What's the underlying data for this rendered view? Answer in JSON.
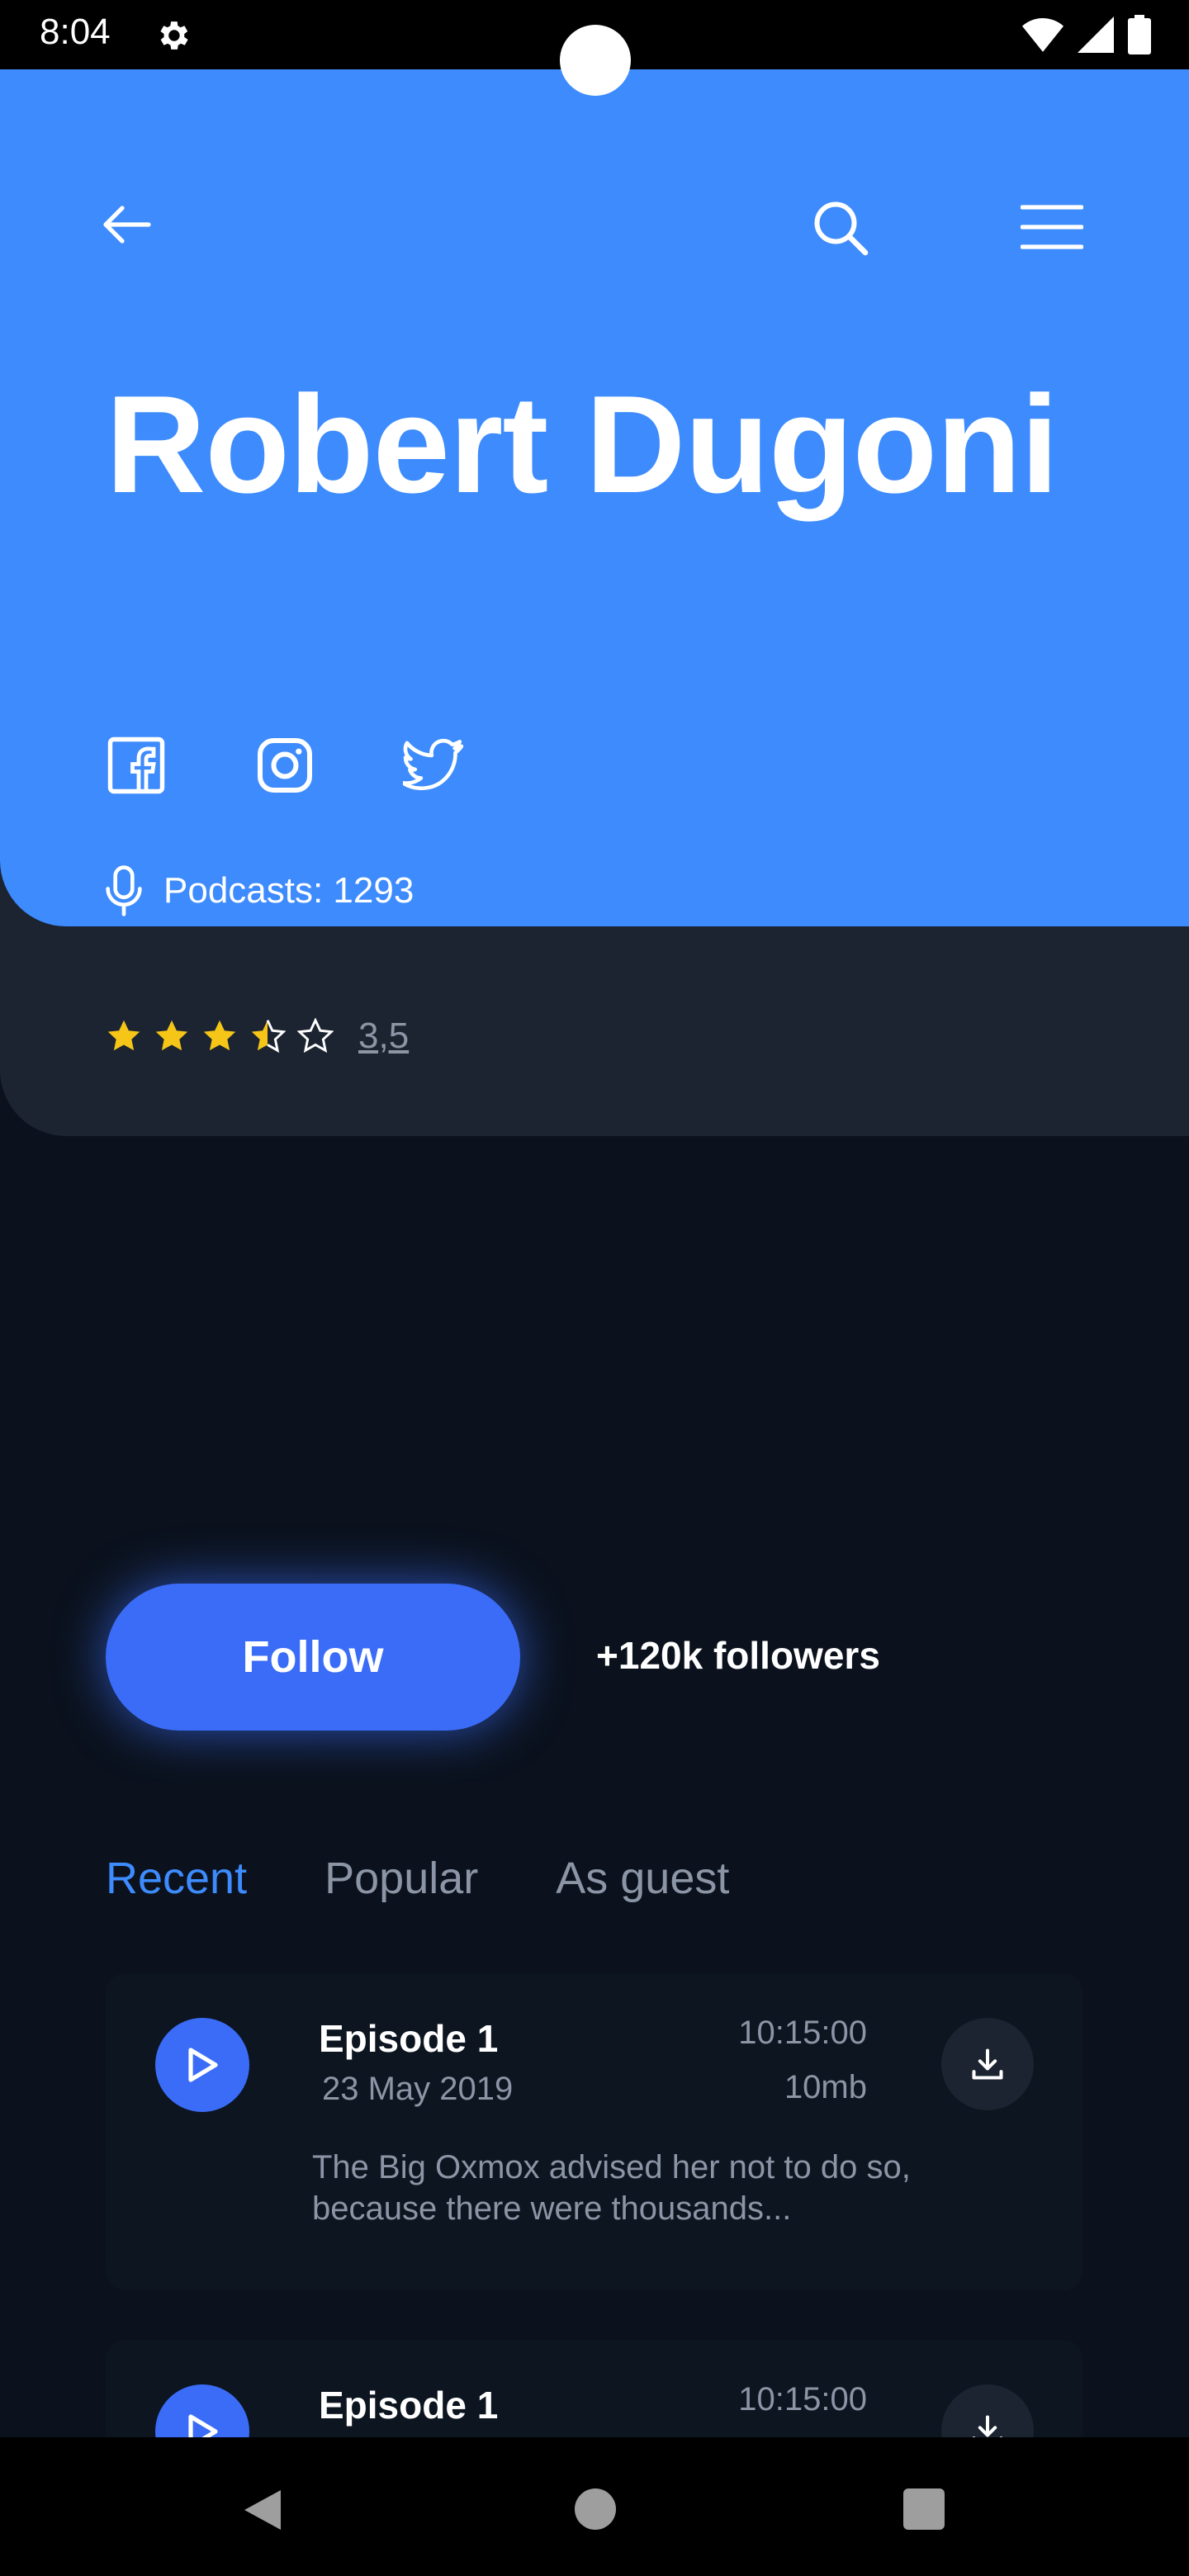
{
  "status_bar": {
    "time": "8:04"
  },
  "header": {
    "name": "Robert Dugoni",
    "podcasts_label": "Podcasts: 1293",
    "accent_color": "#3d8bfd"
  },
  "rating": {
    "value_label": "3,5",
    "value": 3.5,
    "max": 5
  },
  "follow": {
    "button_label": "Follow",
    "followers_label": "+120k followers"
  },
  "tabs": [
    {
      "label": "Recent",
      "active": true
    },
    {
      "label": "Popular",
      "active": false
    },
    {
      "label": "As guest",
      "active": false
    }
  ],
  "episodes": [
    {
      "title": "Episode 1",
      "date": "23 May 2019",
      "duration": "10:15:00",
      "size": "10mb",
      "description": "The Big Oxmox advised her not to do so, because there were thousands..."
    },
    {
      "title": "Episode 1",
      "duration": "10:15:00"
    }
  ],
  "icons": [
    "settings-gear-icon",
    "wifi-icon",
    "signal-icon",
    "battery-icon",
    "back-arrow-icon",
    "search-icon",
    "menu-icon",
    "facebook-icon",
    "instagram-icon",
    "twitter-icon",
    "microphone-icon",
    "star-icon",
    "play-icon",
    "download-icon"
  ]
}
